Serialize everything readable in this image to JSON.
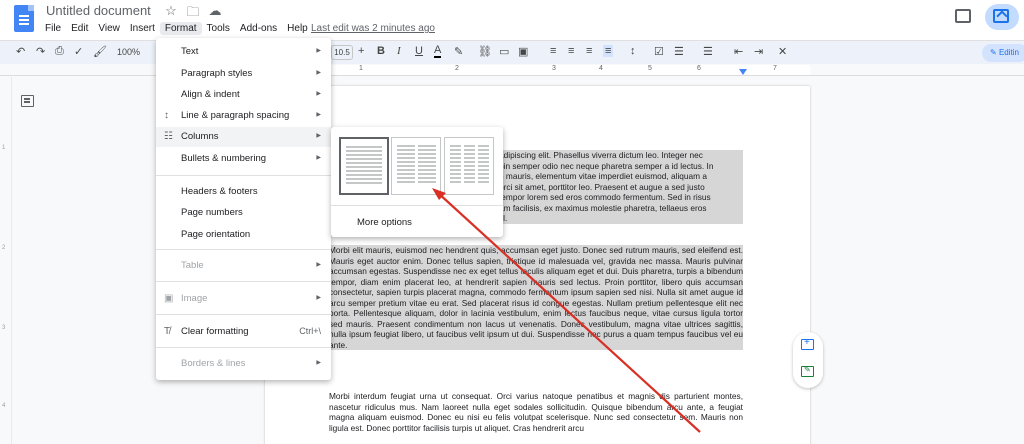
{
  "document": {
    "title": "Untitled document",
    "last_edit": "Last edit was 2 minutes ago"
  },
  "menubar": [
    "File",
    "Edit",
    "View",
    "Insert",
    "Format",
    "Tools",
    "Add-ons",
    "Help"
  ],
  "toolbar": {
    "zoom": "100%",
    "font_size": "10.5",
    "editing_label": "Editin"
  },
  "ruler": {
    "numbers": [
      "1",
      "2",
      "3",
      "4",
      "5",
      "6",
      "7"
    ]
  },
  "vertical_ruler": [
    "1",
    "2",
    "3",
    "4"
  ],
  "format_menu": {
    "items": [
      {
        "label": "Text",
        "submenu": true,
        "icon": ""
      },
      {
        "label": "Paragraph styles",
        "submenu": true,
        "icon": ""
      },
      {
        "label": "Align & indent",
        "submenu": true,
        "icon": ""
      },
      {
        "label": "Line & paragraph spacing",
        "submenu": true,
        "icon": "line-spacing-icon"
      },
      {
        "label": "Columns",
        "submenu": true,
        "icon": "columns-icon",
        "highlighted": true
      },
      {
        "label": "Bullets & numbering",
        "submenu": true,
        "icon": ""
      },
      {
        "label": "Headers & footers",
        "submenu": false,
        "icon": ""
      },
      {
        "label": "Page numbers",
        "submenu": false,
        "icon": ""
      },
      {
        "label": "Page orientation",
        "submenu": false,
        "icon": ""
      },
      {
        "label": "Table",
        "submenu": true,
        "icon": "",
        "disabled": true
      },
      {
        "label": "Image",
        "submenu": true,
        "icon": "image-icon",
        "disabled": true
      },
      {
        "label": "Clear formatting",
        "submenu": false,
        "icon": "clear-formatting-icon",
        "shortcut": "Ctrl+\\"
      },
      {
        "label": "Borders & lines",
        "submenu": true,
        "icon": "",
        "disabled": true
      }
    ]
  },
  "columns_menu": {
    "options": [
      "one-column",
      "two-columns",
      "three-columns"
    ],
    "selected": "one-column",
    "more_options": "More options"
  },
  "body_text": {
    "para1": "adipiscing elit. Phasellus viverra dictum leo. Integer nec\npin semper odio nec neque pharetra semper a id lectus. In\nn mauris, elementum vitae imperdiet euismod, aliquam a\norci sit amet, porttitor leo. Praesent et augue a sed justo\ntempor lorem sed eros commodo fermentum. Sed in risus\nam facilisis, ex maximus molestie pharetra, tellaeus eros\nsl.",
    "para2": "Morbi elit mauris, euismod nec hendrent quis, accumsan eget justo. Donec sed rutrum mauris, sed eleifend est. Mauris eget auctor enim. Donec tellus sapien, tristique id malesuada vel, gravida nec massa. Mauris pulvinar accumsan egestas. Suspendisse nec ex eget tellus iaculis aliquam eget et dui. Duis pharetra, turpis a bibendum tempor, diam enim placerat leo, at hendrerit sapien mauris sed lectus. Proin porttitor, libero quis accumsan consectetur, sapien turpis placerat magna, commodo fermentum ipsum sapien sed nisi. Nulla sit amet augue id arcu semper pretium vitae eu erat. Sed placerat risus id congue egestas. Nullam pretium pellentesque elit nec porta. Pellentesque aliquam, dolor in lacinia vestibulum, enim lectus faucibus neque, vitae cursus ligula tortor sed mauris. Praesent condimentum non lacus ut venenatis. Donec vestibulum, magna vitae ultrices sagittis, nulla ipsum feugiat libero, ut faucibus velit ipsum ut dui. Suspendisse nec purus a quam tempus faucibus vel eu ante.",
    "para3": "Morbi interdum feugiat urna ut consequat. Orci varius natoque penatibus et magnis dis parturient montes, nascetur ridiculus mus. Nam laoreet nulla eget sodales sollicitudin. Quisque bibendum arcu ante, a feugiat magna aliquam euismod. Donec eu nisi eu felis volutpat scelerisque. Nunc sed consectetur sem. Mauris non ligula est. Donec porttitor facilisis turpis ut aliquet. Cras hendrerit arcu"
  },
  "annotation": {
    "color": "#d93025",
    "target": "two-columns"
  },
  "colors": {
    "accent": "#1a73e8",
    "selection": "#d6d6d6",
    "menu_hover": "#f1f3f4"
  }
}
